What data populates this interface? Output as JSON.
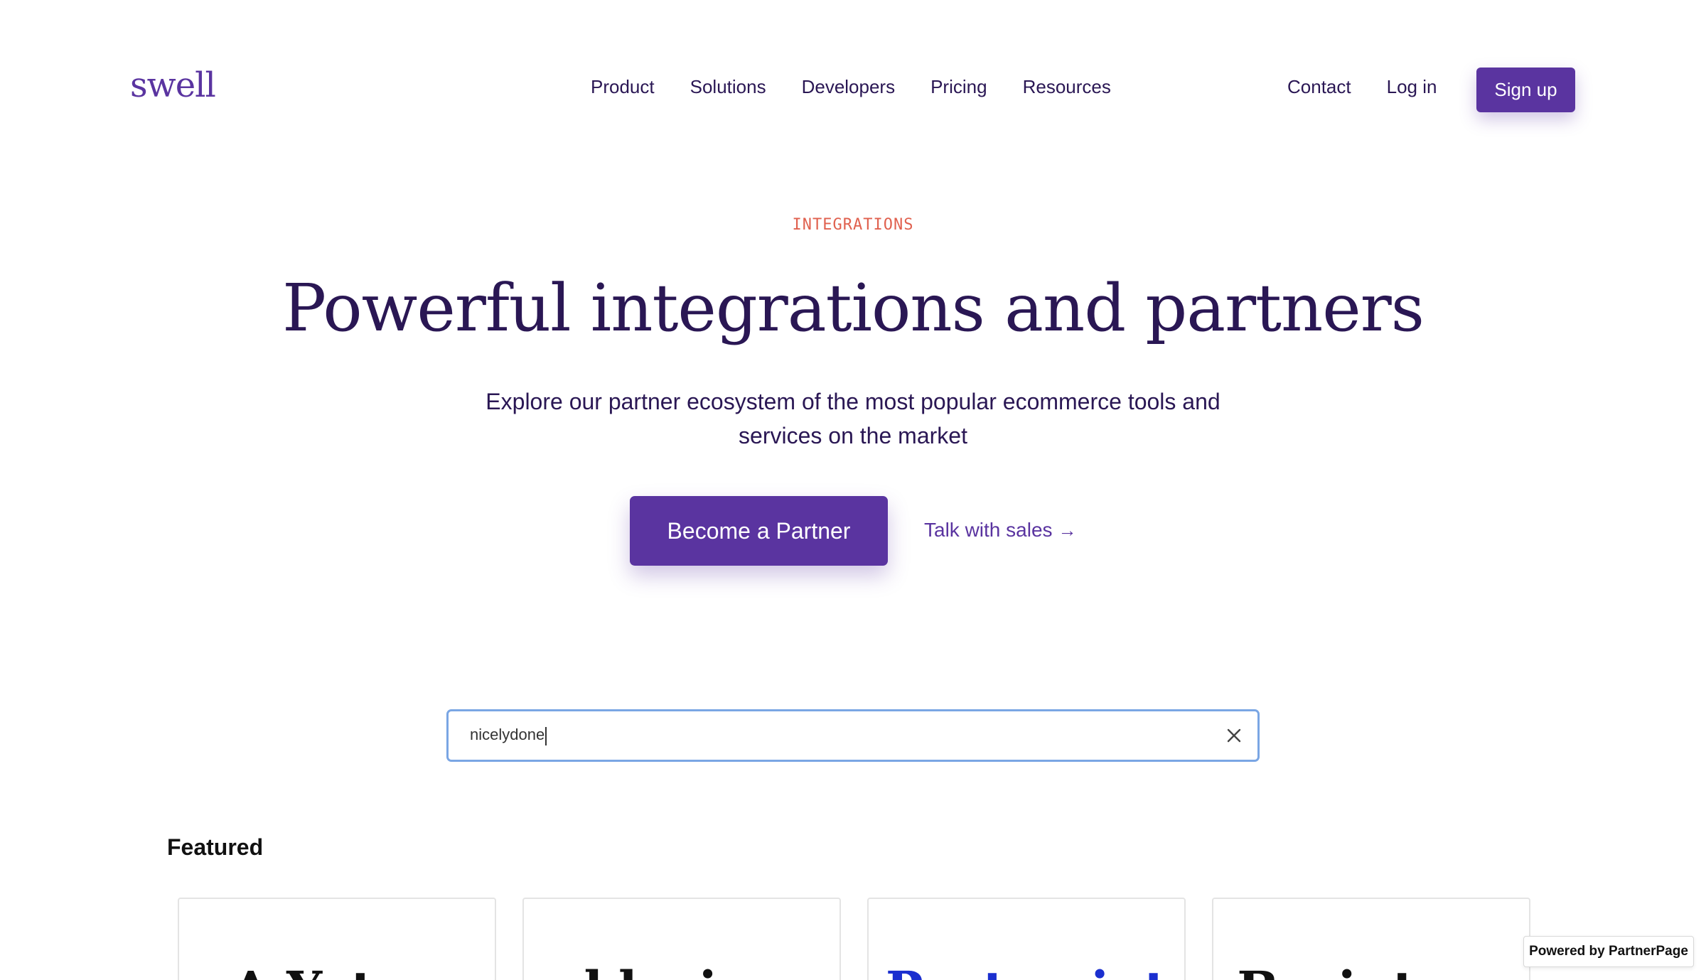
{
  "header": {
    "logo": "swell",
    "nav": [
      "Product",
      "Solutions",
      "Developers",
      "Pricing",
      "Resources"
    ],
    "contact": "Contact",
    "login": "Log in",
    "signup": "Sign up"
  },
  "hero": {
    "eyebrow": "INTEGRATIONS",
    "headline": "Powerful integrations and partners",
    "subtitle": "Explore our partner ecosystem of the most popular ecommerce tools and services on the market",
    "cta_primary": "Become a Partner",
    "cta_secondary": "Talk with sales",
    "cta_secondary_arrow": "→"
  },
  "search": {
    "value": "nicelydone"
  },
  "featured": {
    "title": "Featured",
    "cards": [
      {
        "logo_text": "∆ Yotpo"
      },
      {
        "logo_text": "klaviyo"
      },
      {
        "logo_text": "Postscript"
      },
      {
        "logo_text": "Braintree"
      }
    ]
  },
  "badge": "Powered by PartnerPage",
  "colors": {
    "brand": "#5a34a0",
    "text": "#2a1754",
    "accent": "#e0614f",
    "focus": "#7aa6e4"
  }
}
